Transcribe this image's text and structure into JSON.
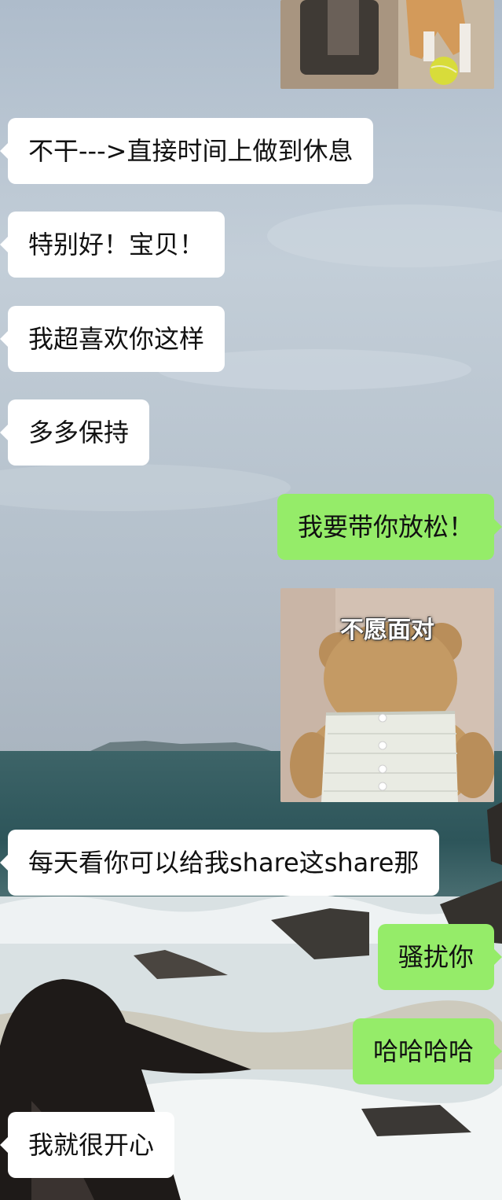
{
  "messages": [
    {
      "side": "in",
      "text": "不干--->直接时间上做到休息"
    },
    {
      "side": "in",
      "text": "特别好！宝贝！"
    },
    {
      "side": "in",
      "text": "我超喜欢你这样"
    },
    {
      "side": "in",
      "text": "多多保持"
    },
    {
      "side": "out",
      "text": "我要带你放松！"
    },
    {
      "side": "in",
      "text": "每天看你可以给我share这share那"
    },
    {
      "side": "out",
      "text": "骚扰你"
    },
    {
      "side": "out",
      "text": "哈哈哈哈"
    },
    {
      "side": "in",
      "text": "我就很开心"
    }
  ],
  "stickers": {
    "dog": {
      "icon": "dog-with-tennis-ball-sticker"
    },
    "bear": {
      "caption": "不愿面对",
      "icon": "teddy-bear-back-sticker"
    }
  },
  "colors": {
    "incoming_bubble": "#ffffff",
    "outgoing_bubble": "#95ec69",
    "sky": "#b9c6d3",
    "sea": "#2f5a5e"
  }
}
